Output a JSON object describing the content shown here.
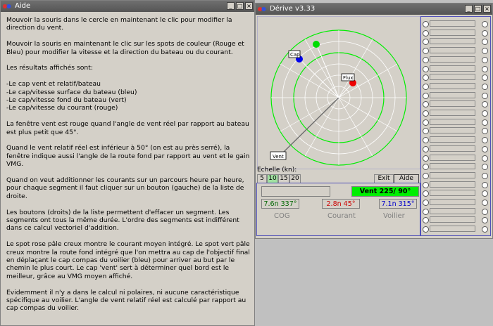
{
  "help_window": {
    "title": "Aide",
    "paragraphs": [
      "Mouvoir la souris dans le cercle en maintenant le clic pour modifier la direction du vent.",
      "Mouvoir la souris en maintenant le clic sur les spots de couleur (Rouge et Bleu) pour modifier la vitesse et la direction du bateau ou du courant.",
      "Les résultats affichés sont:",
      "-Le cap vent et relatif/bateau\n-Le cap/vitesse surface du bateau (bleu)\n-Le cap/vitesse fond du bateau (vert)\n-Le cap/vitesse du courant (rouge)",
      "La fenêtre vent est rouge quand l'angle de vent réel par rapport au bateau est plus petit que 45°.",
      "Quand le vent relatif réel est inférieur à 50° (on est au près serré), la fenêtre indique aussi l'angle de la route fond par rapport au vent et le gain VMG.",
      "Quand on veut additionner les courants sur un parcours heure par heure, pour chaque segment il faut cliquer sur un bouton (gauche) de la liste de droite.",
      "Les boutons (droits) de la liste permettent d'effacer un segment. Les segments ont tous la même durée. L'ordre des segments est indifférent dans ce calcul vectoriel d'addition.",
      "Le spot rose pâle creux montre le courant moyen intégré. Le spot vert pâle creux montre la route fond intégré que l'on mettra au cap de l'objectif final en déplaçant le cap compas du voilier (bleu) pour arriver au but par le chemin le plus court. Le cap 'vent' sert à déterminer quel bord est le meilleur, grâce au VMG moyen affiché.",
      "Evidemment il n'y a dans le calcul ni polaires, ni aucune caractéristique spécifique au voilier. L'angle de vent relatif réel est calculé par rapport au cap compas du voilier."
    ]
  },
  "derive_window": {
    "title": "Dérive v3.33",
    "wind": {
      "speed": 225,
      "angle_deg": 90,
      "label": "Vent 225/ 90°"
    },
    "spot_labels": {
      "cap": "Cap",
      "flux": "Flux",
      "vent": "Vent"
    },
    "scale": {
      "label": "Echelle (kn):",
      "options": [
        "5",
        "10",
        "15",
        "20"
      ],
      "selected": "10"
    },
    "exit_label": "Exit",
    "help_label": "Aide",
    "cog": {
      "value": "7.6n  337°",
      "label": "COG"
    },
    "current": {
      "value": "2.8n  45°",
      "label": "Courant"
    },
    "sailboat": {
      "value": "7.1n  315°",
      "label": "Voilier"
    },
    "segment_count": 24,
    "colors": {
      "wind_green": "#00ee00",
      "cog_green": "#00dd00",
      "boat_blue": "#0000ee",
      "current_red": "#ee0000",
      "frame_blue": "#5050b8"
    }
  }
}
